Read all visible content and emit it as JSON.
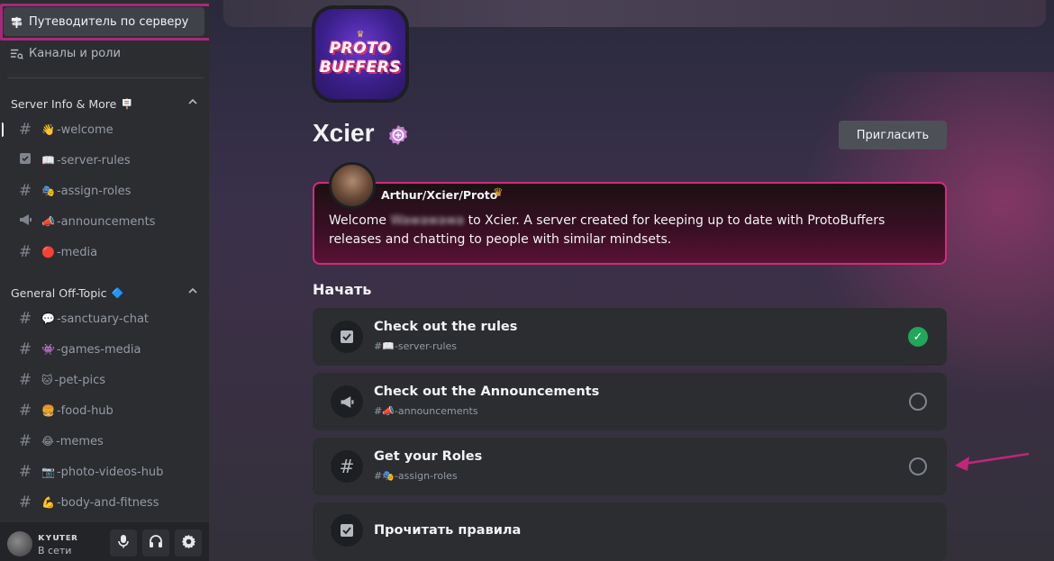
{
  "sidebar": {
    "guide_label": "Путеводитель по серверу",
    "roles_label": "Каналы и роли",
    "categories": [
      {
        "name": "Server Info & More",
        "emoji": "🪧",
        "channels": [
          {
            "emoji": "👋",
            "name": "-welcome",
            "icon": "hash"
          },
          {
            "emoji": "📖",
            "name": "-server-rules",
            "icon": "rules"
          },
          {
            "emoji": "🎭",
            "name": "-assign-roles",
            "icon": "hash"
          },
          {
            "emoji": "📣",
            "name": "-announcements",
            "icon": "megaphone"
          },
          {
            "emoji": "🔴",
            "name": "-media",
            "icon": "hash"
          }
        ]
      },
      {
        "name": "General Off-Topic",
        "emoji": "🔷",
        "channels": [
          {
            "emoji": "💬",
            "name": "-sanctuary-chat",
            "icon": "hash"
          },
          {
            "emoji": "👾",
            "name": "-games-media",
            "icon": "hash"
          },
          {
            "emoji": "🐱",
            "name": "-pet-pics",
            "icon": "hash"
          },
          {
            "emoji": "🍔",
            "name": "-food-hub",
            "icon": "hash"
          },
          {
            "emoji": "😂",
            "name": "-memes",
            "icon": "hash"
          },
          {
            "emoji": "📷",
            "name": "-photo-videos-hub",
            "icon": "hash"
          },
          {
            "emoji": "💪",
            "name": "-body-and-fitness",
            "icon": "hash-thread"
          }
        ]
      }
    ]
  },
  "user_panel": {
    "username": "ᴋʏᴜᴛᴇʀ",
    "status": "В сети"
  },
  "server": {
    "logo_line1": "PROTO",
    "logo_line2": "BUFFERS",
    "name": "Xcier",
    "invite_label": "Пригласить"
  },
  "welcome": {
    "author": "Arthur/Xcier/Proto",
    "text_before": "Welcome ",
    "text_blurred": "Wawawawa",
    "text_after": " to Xcier. A server created for keeping up to date with ProtoBuffers releases and chatting to people with similar mindsets."
  },
  "onboarding": {
    "title": "Начать",
    "tasks": [
      {
        "title": "Check out the rules",
        "channel": "#📖-server-rules",
        "done": true
      },
      {
        "title": "Check out the Announcements",
        "channel": "#📣-announcements",
        "done": false
      },
      {
        "title": "Get your Roles",
        "channel": "#🎭-assign-roles",
        "done": false
      },
      {
        "title": "Прочитать правила",
        "channel": "",
        "done": false
      }
    ]
  },
  "colors": {
    "accent": "#d42a7d",
    "success": "#23a55a",
    "highlight": "#a8287a"
  }
}
